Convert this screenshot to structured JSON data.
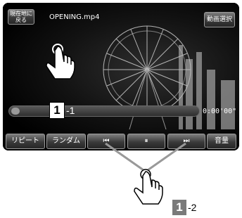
{
  "topbar": {
    "back_label": "現在地に\n戻る",
    "file_name": "OPENING.mp4",
    "select_label": "動画選択"
  },
  "progress": {
    "time": "0:00'00\"",
    "value": 0.02
  },
  "controls": {
    "repeat_label": "リピート",
    "random_label": "ランダム",
    "prev_label": "⏮",
    "pause_label": "⏸",
    "next_label": "⏭",
    "volume_label": "音量"
  },
  "callouts": {
    "c1_number": "1",
    "c1_suffix": "-1",
    "c2_number": "1",
    "c2_suffix": "-2"
  },
  "icons": [
    "tap-hand-icon",
    "ferris-wheel-graphic"
  ]
}
